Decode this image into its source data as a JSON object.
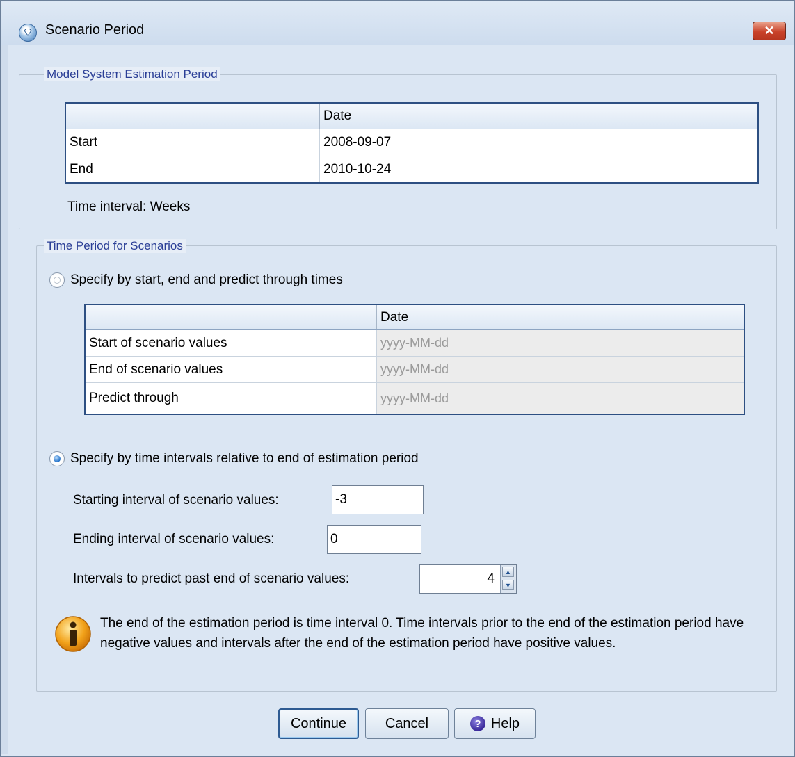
{
  "window": {
    "title": "Scenario Period"
  },
  "estimation_group": {
    "legend": "Model System Estimation Period",
    "table": {
      "header": [
        "",
        "Date"
      ],
      "rows": [
        {
          "label": "Start",
          "date": "2008-09-07"
        },
        {
          "label": "End",
          "date": "2010-10-24"
        }
      ]
    },
    "time_interval": "Time interval: Weeks"
  },
  "scenario_group": {
    "legend": "Time Period for Scenarios",
    "option_dates": {
      "label": "Specify by start, end and predict through times",
      "selected": false
    },
    "dates_table": {
      "header": [
        "",
        "Date"
      ],
      "rows": [
        {
          "label": "Start of scenario values",
          "placeholder": "yyyy-MM-dd"
        },
        {
          "label": "End of scenario values",
          "placeholder": "yyyy-MM-dd"
        },
        {
          "label": "Predict through",
          "placeholder": "yyyy-MM-dd"
        }
      ]
    },
    "option_intervals": {
      "label": "Specify by time intervals relative to end of estimation period",
      "selected": true
    },
    "starting_interval": {
      "label": "Starting interval of scenario values:",
      "value": "-3"
    },
    "ending_interval": {
      "label": "Ending interval of scenario values:",
      "value": "0"
    },
    "predict_intervals": {
      "label": "Intervals to predict past end of scenario values:",
      "value": "4"
    },
    "note": "The end of the estimation period is time interval 0. Time intervals prior to the end of the estimation period have negative values and intervals after the end of the estimation period have positive values."
  },
  "buttons": {
    "continue": "Continue",
    "cancel": "Cancel",
    "help": "Help"
  },
  "icons": {
    "app": "scenario-app-icon",
    "close": "close-icon",
    "info": "info-icon",
    "help": "help-icon"
  }
}
